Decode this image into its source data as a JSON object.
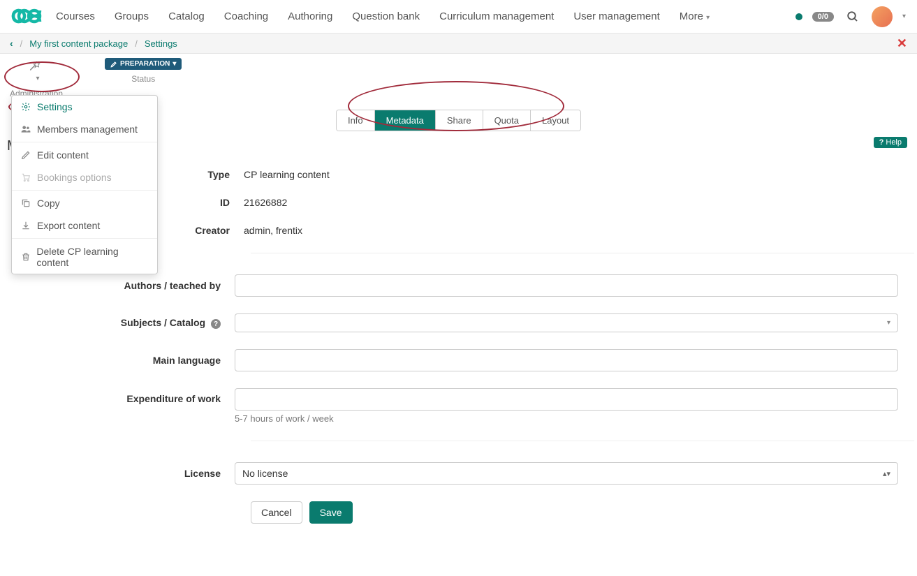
{
  "nav": {
    "items": [
      "Courses",
      "Groups",
      "Catalog",
      "Coaching",
      "Authoring",
      "Question bank",
      "Curriculum management",
      "User management"
    ],
    "more": "More",
    "badge": "0/0"
  },
  "breadcrumb": {
    "back": "‹",
    "parent": "My first content package",
    "current": "Settings"
  },
  "toolbar": {
    "administration": "Administration",
    "status_label": "Status",
    "status_value": "PREPARATION"
  },
  "dropdown": {
    "settings": "Settings",
    "members": "Members management",
    "edit": "Edit content",
    "bookings": "Bookings options",
    "copy": "Copy",
    "export": "Export content",
    "delete": "Delete CP learning content"
  },
  "tabs": [
    "Info",
    "Metadata",
    "Share",
    "Quota",
    "Layout"
  ],
  "help": "Help",
  "form": {
    "type_label": "Type",
    "type_value": "CP learning content",
    "id_label": "ID",
    "id_value": "21626882",
    "creator_label": "Creator",
    "creator_value": "admin, frentix",
    "authors_label": "Authors / teached by",
    "subjects_label": "Subjects / Catalog",
    "lang_label": "Main language",
    "expend_label": "Expenditure of work",
    "expend_hint": "5-7 hours of work / week",
    "license_label": "License",
    "license_value": "No license",
    "cancel": "Cancel",
    "save": "Save"
  },
  "peek": "M"
}
